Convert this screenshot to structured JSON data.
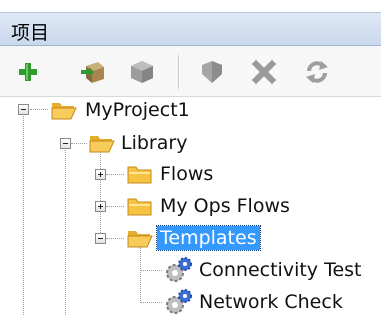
{
  "panel": {
    "title": "项目"
  },
  "toolbar": {
    "buttons": [
      {
        "icon": "add-icon",
        "enabled": true
      },
      {
        "icon": "import-box-icon",
        "enabled": true
      },
      {
        "icon": "cube-icon",
        "enabled": false
      },
      {
        "icon": "shield-icon",
        "enabled": false
      },
      {
        "icon": "delete-x-icon",
        "enabled": false
      },
      {
        "icon": "refresh-icon",
        "enabled": false
      }
    ]
  },
  "tree": {
    "project": {
      "label": "MyProject1",
      "expanded": true
    },
    "library": {
      "label": "Library",
      "expanded": true
    },
    "flows": {
      "label": "Flows",
      "expanded": false
    },
    "my_ops_flows": {
      "label": "My Ops Flows",
      "expanded": false
    },
    "templates": {
      "label": "Templates",
      "expanded": true,
      "selected": true
    },
    "connectivity_test": {
      "label": "Connectivity Test"
    },
    "network_check": {
      "label": "Network Check"
    }
  },
  "colors": {
    "selection": "#3399ff",
    "folder": "#f5c542",
    "gear": "#3a6fd8"
  }
}
